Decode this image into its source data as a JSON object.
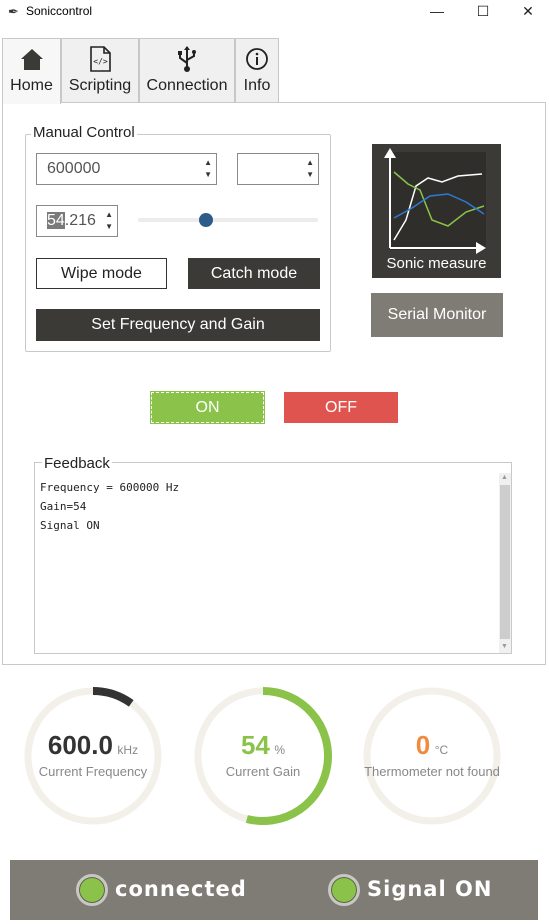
{
  "window": {
    "title": "Soniccontrol",
    "app_icon": "feather-icon",
    "minimize": "—",
    "maximize": "☐",
    "close": "✕"
  },
  "tabs": [
    {
      "label": "Home",
      "icon": "home-icon",
      "active": true
    },
    {
      "label": "Scripting",
      "icon": "script-file-icon",
      "active": false
    },
    {
      "label": "Connection",
      "icon": "usb-icon",
      "active": false
    },
    {
      "label": "Info",
      "icon": "info-icon",
      "active": false
    }
  ],
  "manual_control": {
    "legend": "Manual Control",
    "frequency_value": "600000",
    "scale_value": "",
    "gain_value_selected": "54",
    "gain_value_rest": ".216",
    "gain_slider_fraction": 0.375,
    "wipe_mode": "Wipe mode",
    "catch_mode": "Catch mode",
    "set_button": "Set Frequency and Gain"
  },
  "sonic_measure": {
    "label": "Sonic measure",
    "icon": "line-chart-icon"
  },
  "serial_monitor": {
    "label": "Serial Monitor"
  },
  "signal_buttons": {
    "on": "ON",
    "off": "OFF"
  },
  "feedback": {
    "legend": "Feedback",
    "text": "Frequency = 600000 Hz\nGain=54\nSignal ON"
  },
  "gauges": [
    {
      "value": "600.0",
      "unit": "kHz",
      "label": "Current Frequency",
      "fraction": 0.1,
      "color": "#333333"
    },
    {
      "value": "54",
      "unit": "%",
      "label": "Current Gain",
      "fraction": 0.54,
      "color": "#8bc34a"
    },
    {
      "value": "0",
      "unit": "°C",
      "label": "Thermometer not found",
      "fraction": 0.0,
      "color": "#f08a3c"
    }
  ],
  "status": {
    "connection": "connected",
    "signal": "Signal ON",
    "led_color": "#8bc34a"
  }
}
